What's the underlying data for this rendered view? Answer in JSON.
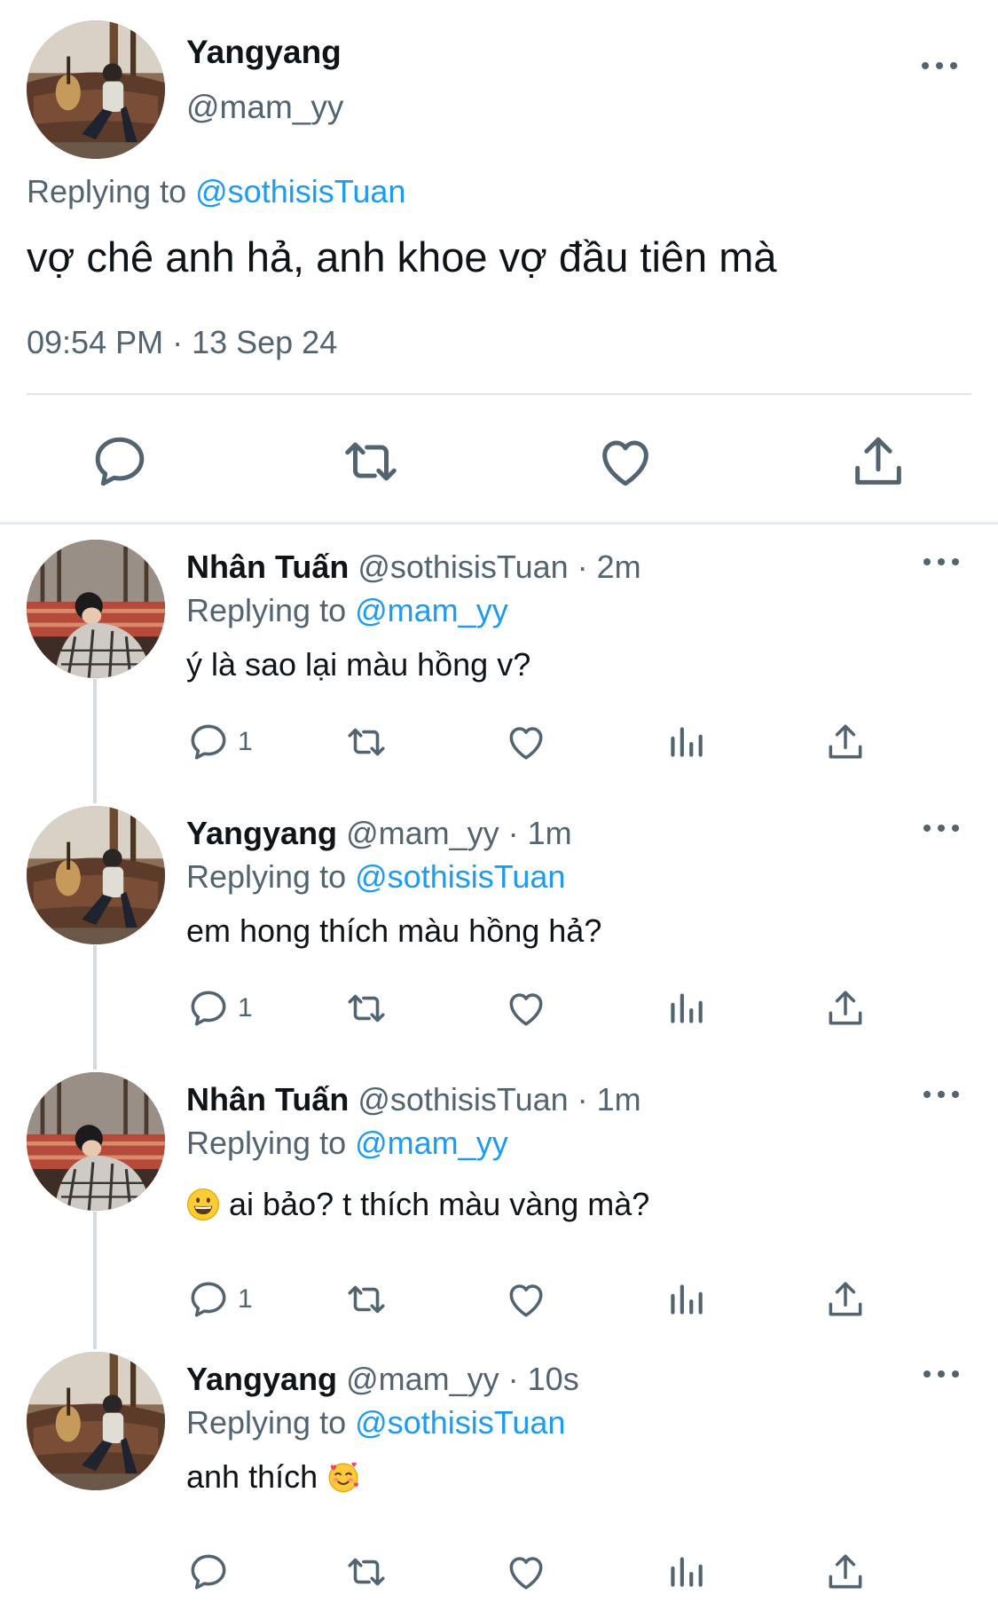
{
  "main_tweet": {
    "author_name": "Yangyang",
    "author_handle": "@mam_yy",
    "replying_prefix": "Replying to",
    "replying_to": "@sothisisTuan",
    "text": "vợ chê anh hả, anh khoe vợ đầu tiên mà",
    "timestamp": "09:54 PM · 13 Sep 24",
    "actions": [
      "reply-icon",
      "retweet-icon",
      "like-icon",
      "share-icon"
    ]
  },
  "replies": [
    {
      "author_name": "Nhân Tuấn",
      "author_handle": "@sothisisTuan",
      "time_ago": "· 2m",
      "replying_prefix": "Replying to",
      "replying_to": "@mam_yy",
      "text": "ý là sao lại màu hồng v?",
      "reply_count": "1"
    },
    {
      "author_name": "Yangyang",
      "author_handle": "@mam_yy",
      "time_ago": "· 1m",
      "replying_prefix": "Replying to",
      "replying_to": "@sothisisTuan",
      "text": "em hong thích màu hồng hả?",
      "reply_count": "1"
    },
    {
      "author_name": "Nhân Tuấn",
      "author_handle": "@sothisisTuan",
      "time_ago": "· 1m",
      "replying_prefix": "Replying to",
      "replying_to": "@mam_yy",
      "text": "ai bảo? t thích màu vàng mà?",
      "leading_emoji": "grinning-face-emoji",
      "reply_count": "1"
    },
    {
      "author_name": "Yangyang",
      "author_handle": "@mam_yy",
      "time_ago": "· 10s",
      "replying_prefix": "Replying to",
      "replying_to": "@sothisisTuan",
      "text": "anh thích",
      "trailing_emoji": "smiling-face-with-hearts-emoji",
      "reply_count": ""
    }
  ],
  "colors": {
    "text": "#0f1419",
    "secondary": "#536471",
    "link": "#1d9bf0",
    "divider": "#e1e5e8"
  }
}
